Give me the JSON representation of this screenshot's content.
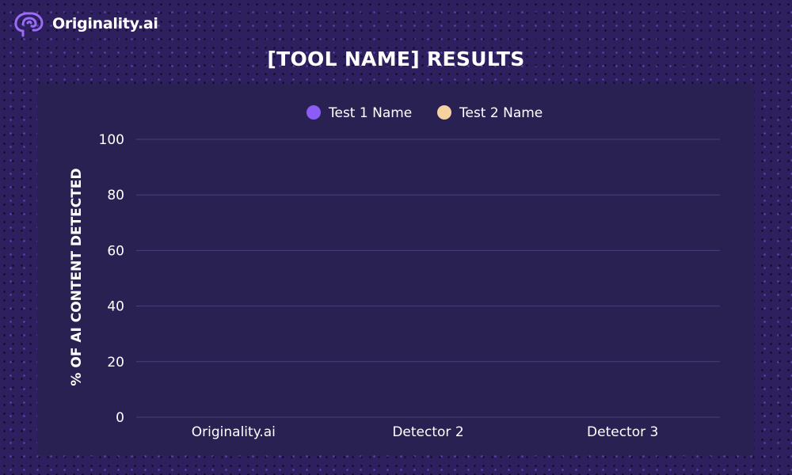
{
  "brand": {
    "name": "Originality.ai",
    "logo_icon": "brain-icon"
  },
  "colors": {
    "background": "#2e1f5e",
    "panel": "#2a2153",
    "gridline": "#4a3f7a",
    "text": "#ffffff",
    "series_1": "#8b5cf6",
    "series_2": "#f6d2a0"
  },
  "chart_data": {
    "type": "bar",
    "title": "[TOOL NAME] RESULTS",
    "ylabel": "% OF AI CONTENT DETECTED",
    "xlabel": "",
    "categories": [
      "Originality.ai",
      "Detector 2",
      "Detector 3"
    ],
    "ylim": [
      0,
      100
    ],
    "yticks": [
      0,
      20,
      40,
      60,
      80,
      100
    ],
    "grid": true,
    "legend": "top-center",
    "series": [
      {
        "name": "Test 1 Name",
        "color": "#8b5cf6",
        "values": [
          0,
          0,
          0
        ]
      },
      {
        "name": "Test 2 Name",
        "color": "#f6d2a0",
        "values": [
          0,
          0,
          0
        ]
      }
    ]
  }
}
